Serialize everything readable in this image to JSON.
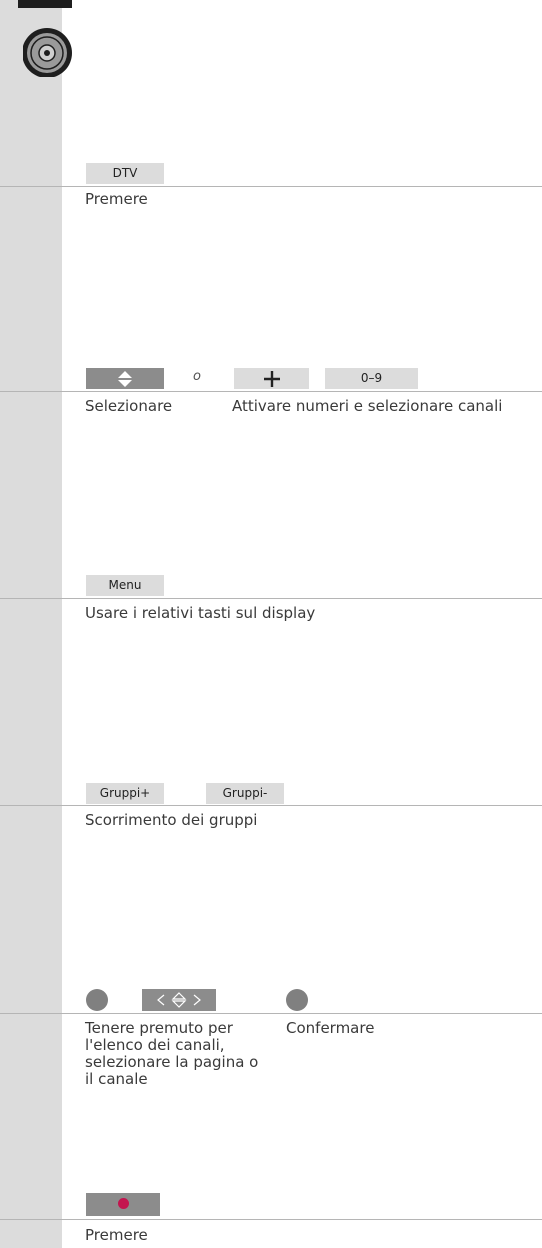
{
  "rows": [
    {
      "key": "DTV",
      "text": "Premere"
    },
    {
      "or_label": "o",
      "num_key": "0–9",
      "text_a": "Selezionare",
      "text_b": "Attivare numeri e selezionare canali"
    },
    {
      "key": "Menu",
      "text": "Usare i relativi tasti sul display"
    },
    {
      "key_a": "Gruppi+",
      "key_b": "Gruppi-",
      "text": "Scorrimento dei gruppi"
    },
    {
      "text_a": "Tenere premuto per l'elenco dei canali, selezionare la pagina o il canale",
      "text_b": "Confermare"
    },
    {
      "text": "Premere"
    }
  ],
  "colors": {
    "sidebar": "#dcdcdc",
    "key_dark": "#8c8c8c",
    "record_red": "#c3154f"
  },
  "icons": [
    "remote-wheel-icon",
    "up-down-arrows-icon",
    "plus-icon",
    "left-right-up-down-arrows-icon",
    "record-dot-icon"
  ]
}
